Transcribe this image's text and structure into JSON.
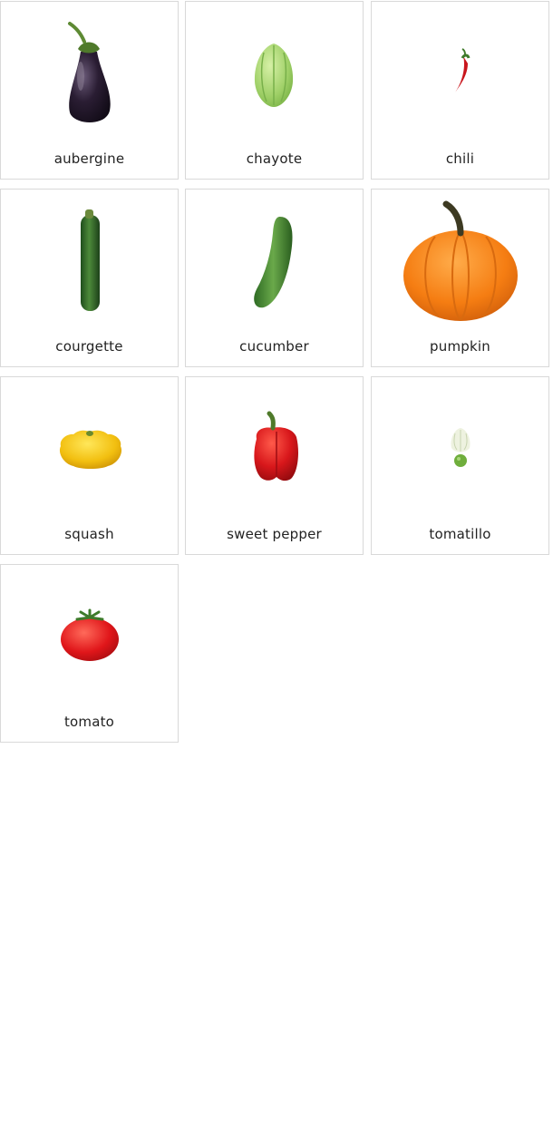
{
  "vegetables": [
    {
      "label": "aubergine",
      "icon": "aubergine-icon"
    },
    {
      "label": "chayote",
      "icon": "chayote-icon"
    },
    {
      "label": "chili",
      "icon": "chili-icon"
    },
    {
      "label": "courgette",
      "icon": "courgette-icon"
    },
    {
      "label": "cucumber",
      "icon": "cucumber-icon"
    },
    {
      "label": "pumpkin",
      "icon": "pumpkin-icon"
    },
    {
      "label": "squash",
      "icon": "squash-icon"
    },
    {
      "label": "sweet pepper",
      "icon": "sweet-pepper-icon"
    },
    {
      "label": "tomatillo",
      "icon": "tomatillo-icon"
    },
    {
      "label": "tomato",
      "icon": "tomato-icon"
    }
  ],
  "colors": {
    "card_border": "#d9d9d9",
    "label_text": "#222222",
    "background": "#ffffff"
  }
}
